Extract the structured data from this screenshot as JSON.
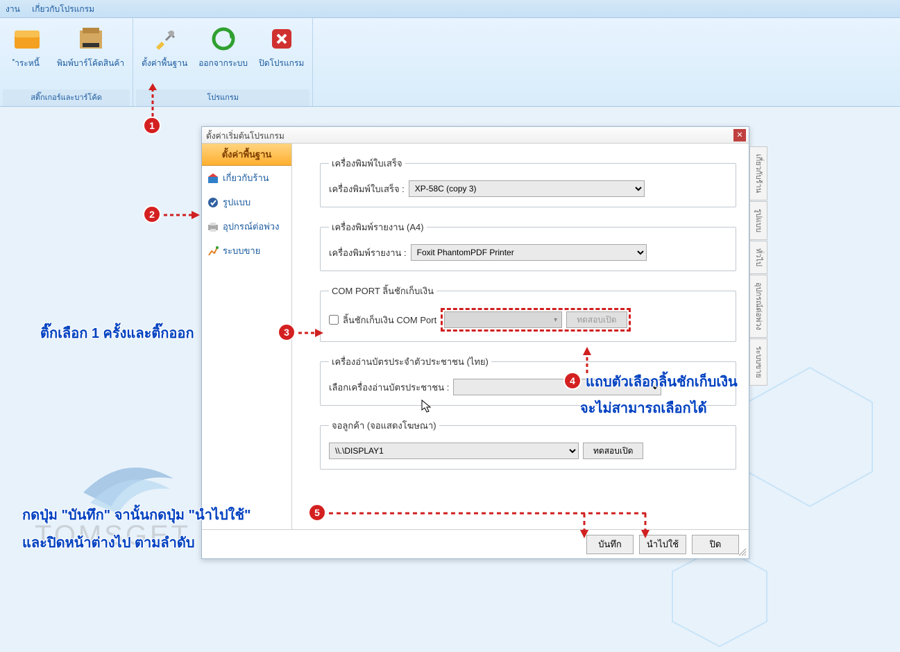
{
  "menubar": {
    "item1": "งาน",
    "item2": "เกี่ยวกับโปรแกรม"
  },
  "ribbon": {
    "group1_label": "สติ๊กเกอร์และบาร์โค้ด",
    "group2_label": "โปรแกรม",
    "b_debt": "ำระหนี้",
    "b_barcode": "พิมพ์บาร์โค้ดสินค้า",
    "b_settings": "ตั้งค่าพื้นฐาน",
    "b_logout": "ออกจากระบบ",
    "b_close": "ปิดโปรแกรม"
  },
  "dialog": {
    "title": "ตั้งค่าเริ่มต้นโปรแกรม",
    "sidebar_header": "ตั้งค่าพื้นฐาน",
    "nav1": "เกี่ยวกับร้าน",
    "nav2": "รูปแบบ",
    "nav3": "อุปกรณ์ต่อพ่วง",
    "nav4": "ระบบขาย",
    "tab_right1": "เกี่ยวกับร้าน",
    "tab_right2": "รูปแบบ",
    "tab_right3": "ทั่วไป",
    "tab_right4": "อุปกรณ์ต่อพ่วง",
    "tab_right5": "ระบบขาย",
    "grp1_legend": "เครื่องพิมพ์ใบเสร็จ",
    "grp1_label": "เครื่องพิมพ์ใบเสร็จ :",
    "grp1_value": "XP-58C (copy 3)",
    "grp2_legend": "เครื่องพิมพ์รายงาน (A4)",
    "grp2_label": "เครื่องพิมพ์รายงาน :",
    "grp2_value": "Foxit PhantomPDF Printer",
    "grp3_legend": "COM PORT ลิ้นชักเก็บเงิน",
    "grp3_chk_label": "ลิ้นชักเก็บเงิน COM Port",
    "grp3_btn": "ทดสอบเปิด",
    "grp4_legend": "เครื่องอ่านบัตรประจำตัวประชาชน (ไทย)",
    "grp4_label": "เลือกเครื่องอ่านบัตรประชาชน :",
    "grp5_legend": "จอลูกค้า (จอแสดงโฆษณา)",
    "grp5_value": "\\\\.\\DISPLAY1",
    "grp5_btn": "ทดสอบเปิด",
    "btn_save": "บันทึก",
    "btn_apply": "นำไปใช้",
    "btn_close": "ปิด"
  },
  "annotations": {
    "n1": "1",
    "n2": "2",
    "n3": "3",
    "n4": "4",
    "n5": "5",
    "text3": "ติ๊กเลือก 1 ครั้งและติ๊กออก",
    "text4a": "แถบตัวเลือกลิ้นชักเก็บเงิน",
    "text4b": "จะไม่สามารถเลือกได้",
    "text5a": "กดปุ่ม \"บันทึก\" จานั้นกดปุ่ม \"นำไปใช้\"",
    "text5b": "และปิดหน้าต่างไป ตามลำดับ"
  },
  "logo_text": "TOMSGET"
}
